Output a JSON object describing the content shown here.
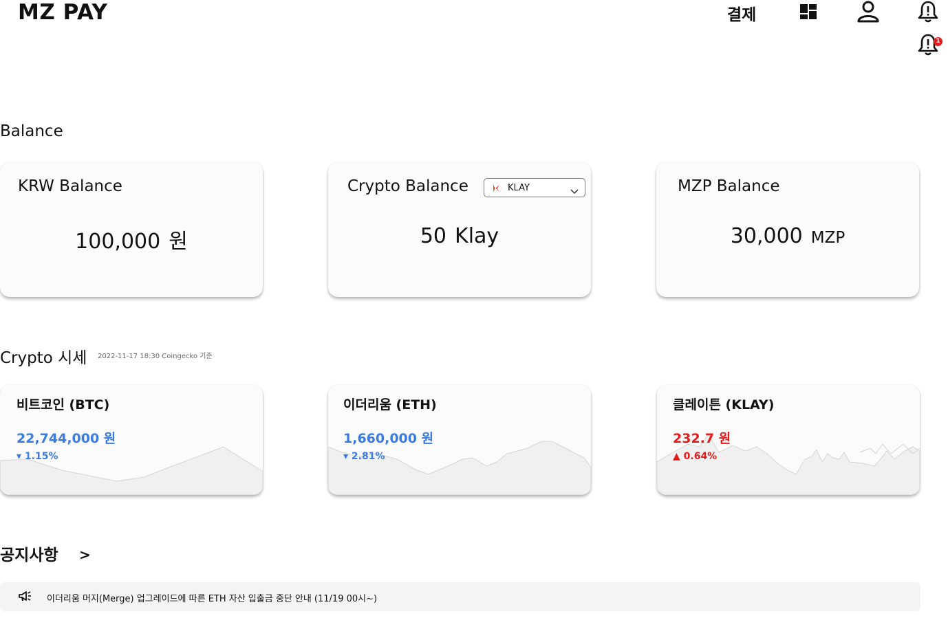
{
  "header": {
    "logo": "MZ PAY",
    "nav_pay": "결제",
    "icons": [
      "dashboard-icon",
      "user-icon",
      "bell-alert-icon"
    ],
    "notification_badge": "1"
  },
  "balance": {
    "section_title": "Balance",
    "krw": {
      "title": "KRW Balance",
      "value": "100,000",
      "unit": "원"
    },
    "crypto": {
      "title": "Crypto Balance",
      "selected_coin": "KLAY",
      "value": "50",
      "unit": "Klay"
    },
    "mzp": {
      "title": "MZP Balance",
      "value": "30,000",
      "unit": "MZP"
    }
  },
  "market": {
    "section_title": "Crypto 시세",
    "timestamp": "2022-11-17 18:30 Coingecko 기준",
    "coins": [
      {
        "name": "비트코인 (BTC)",
        "price": "22,744,000 원",
        "change": "▾ 1.15%",
        "direction": "down",
        "color": "#3a7be0"
      },
      {
        "name": "이더리움 (ETH)",
        "price": "1,660,000 원",
        "change": "▾ 2.81%",
        "direction": "down",
        "color": "#3a7be0"
      },
      {
        "name": "클레이튼 (KLAY)",
        "price": "232.7 원",
        "change": "▲ 0.64%",
        "direction": "up",
        "color": "#e31b1b"
      }
    ]
  },
  "notice": {
    "section_title": "공지사항",
    "arrow": ">",
    "items": [
      {
        "text": "이더리움 머지(Merge) 업그레이드에 따른 ETH 자산 입출금 중단 안내 (11/19 00시~)"
      }
    ]
  }
}
